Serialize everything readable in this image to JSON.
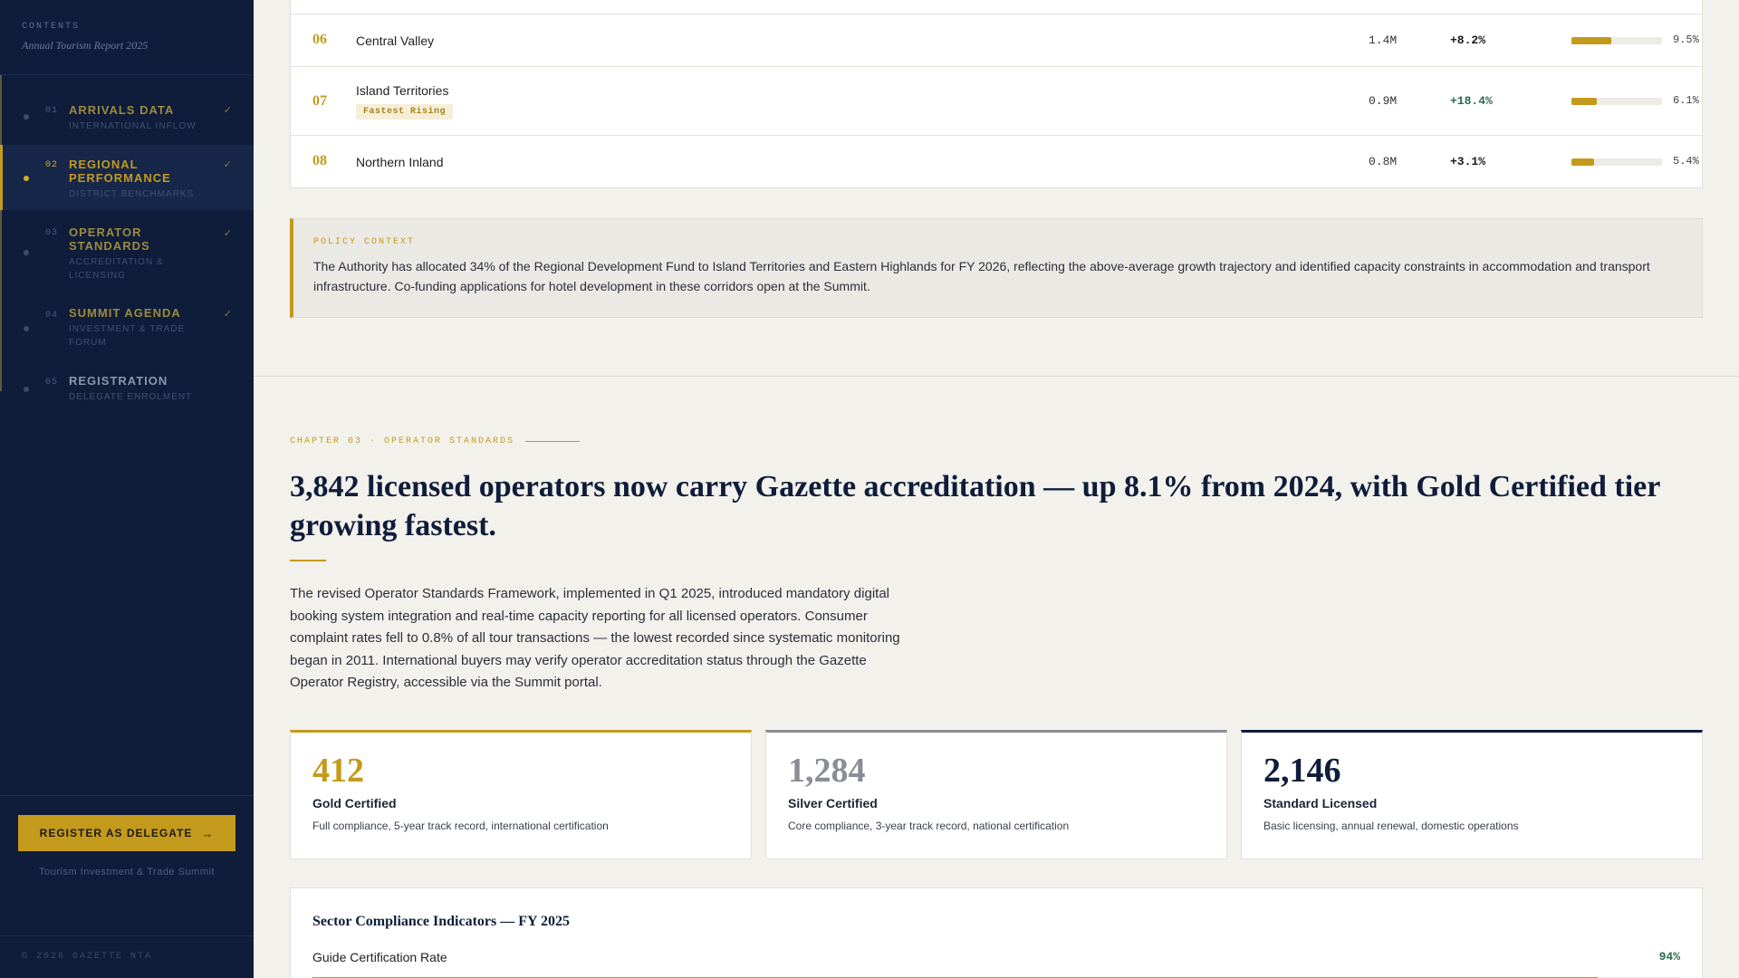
{
  "sidebar": {
    "contents_label": "CONTENTS",
    "report_title": "Annual Tourism Report 2025",
    "items": [
      {
        "num": "01",
        "title": "ARRIVALS DATA",
        "sub": "INTERNATIONAL INFLOW",
        "check": "✓"
      },
      {
        "num": "02",
        "title": "REGIONAL PERFORMANCE",
        "sub": "DISTRICT BENCHMARKS",
        "check": "✓"
      },
      {
        "num": "03",
        "title": "OPERATOR STANDARDS",
        "sub": "ACCREDITATION & LICENSING",
        "check": "✓"
      },
      {
        "num": "04",
        "title": "SUMMIT AGENDA",
        "sub": "INVESTMENT & TRADE FORUM",
        "check": "✓"
      },
      {
        "num": "05",
        "title": "REGISTRATION",
        "sub": "DELEGATE ENROLMENT"
      }
    ],
    "register_label": "REGISTER AS DELEGATE",
    "summit_label": "Tourism Investment & Trade Summit",
    "copyright": "© 2026 GAZETTE NTA"
  },
  "regions": [
    {
      "num": "06",
      "name": "Central Valley",
      "arrivals": "1.4M",
      "growth": "+8.2%",
      "share": "9.5%",
      "share_value": 9.5,
      "highlight": false
    },
    {
      "num": "07",
      "name": "Island Territories",
      "badge": "Fastest Rising",
      "arrivals": "0.9M",
      "growth": "+18.4%",
      "share": "6.1%",
      "share_value": 6.1,
      "highlight": true
    },
    {
      "num": "08",
      "name": "Northern Inland",
      "arrivals": "0.8M",
      "growth": "+3.1%",
      "share": "5.4%",
      "share_value": 5.4,
      "highlight": false
    }
  ],
  "policy": {
    "label": "POLICY CONTEXT",
    "text": "The Authority has allocated 34% of the Regional Development Fund to Island Territories and Eastern Highlands for FY 2026, reflecting the above-average growth trajectory and identified capacity constraints in accommodation and transport infrastructure. Co-funding applications for hotel development in these corridors open at the Summit."
  },
  "chapter": {
    "label": "CHAPTER 03 · OPERATOR STANDARDS",
    "headline": "3,842 licensed operators now carry Gazette accreditation — up 8.1% from 2024, with Gold Certified tier growing fastest.",
    "body": "The revised Operator Standards Framework, implemented in Q1 2025, introduced mandatory digital booking system integration and real-time capacity reporting for all licensed operators. Consumer complaint rates fell to 0.8% of all tour transactions — the lowest recorded since systematic monitoring began in 2011. International buyers may verify operator accreditation status through the Gazette Operator Registry, accessible via the Summit portal."
  },
  "stats": [
    {
      "value": "412",
      "title": "Gold Certified",
      "desc": "Full compliance, 5-year track record, international certification"
    },
    {
      "value": "1,284",
      "title": "Silver Certified",
      "desc": "Core compliance, 3-year track record, national certification"
    },
    {
      "value": "2,146",
      "title": "Standard Licensed",
      "desc": "Basic licensing, annual renewal, domestic operations"
    }
  ],
  "compliance": {
    "title": "Sector Compliance Indicators — FY 2025",
    "rows": [
      {
        "label": "Guide Certification Rate",
        "value": "94%",
        "percent": 94
      }
    ]
  },
  "colors": {
    "accent": "#c49a1c",
    "navy": "#0f1d3a",
    "positive": "#2e6b50"
  }
}
